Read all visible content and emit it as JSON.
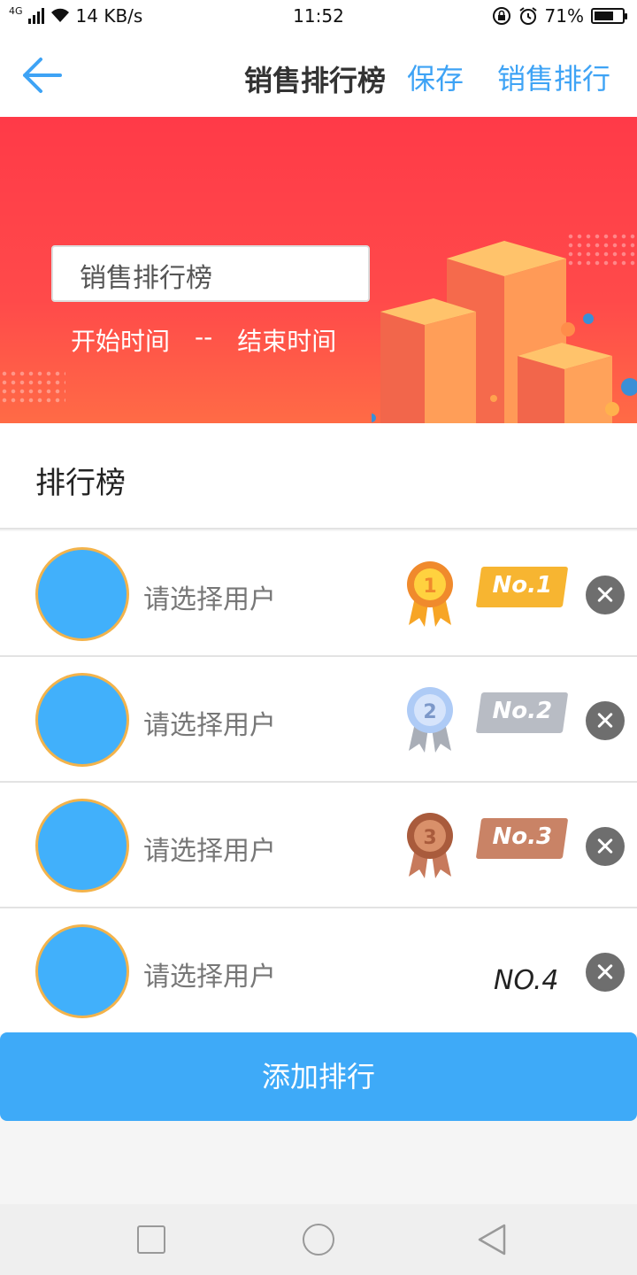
{
  "status_bar": {
    "network": "4G",
    "speed": "14 KB/s",
    "time": "11:52",
    "battery_percent": "71%",
    "battery_level": 0.71
  },
  "header": {
    "title": "销售排行榜",
    "save_label": "保存",
    "rank_label": "销售排行",
    "accent_color": "#3ea3f5"
  },
  "banner": {
    "input_value": "销售排行榜",
    "start_time": "开始时间",
    "separator": "--",
    "end_time": "结束时间",
    "background_color": "#ff3a48"
  },
  "section": {
    "title": "排行榜"
  },
  "rows": [
    {
      "user_placeholder": "请选择用户",
      "rank_label": "No.1",
      "medal": "gold-medal",
      "medal_number": "1",
      "tag_color": "#f7b531"
    },
    {
      "user_placeholder": "请选择用户",
      "rank_label": "No.2",
      "medal": "silver-medal",
      "medal_number": "2",
      "tag_color": "#b8bcc4"
    },
    {
      "user_placeholder": "请选择用户",
      "rank_label": "No.3",
      "medal": "bronze-medal",
      "medal_number": "3",
      "tag_color": "#c98366"
    },
    {
      "user_placeholder": "请选择用户",
      "rank_label": "NO.4",
      "medal": null
    }
  ],
  "add_button": {
    "label": "添加排行",
    "color": "#3eaaf8"
  },
  "nav_bar": {
    "icons": [
      "recents-icon",
      "home-icon",
      "back-icon"
    ]
  }
}
